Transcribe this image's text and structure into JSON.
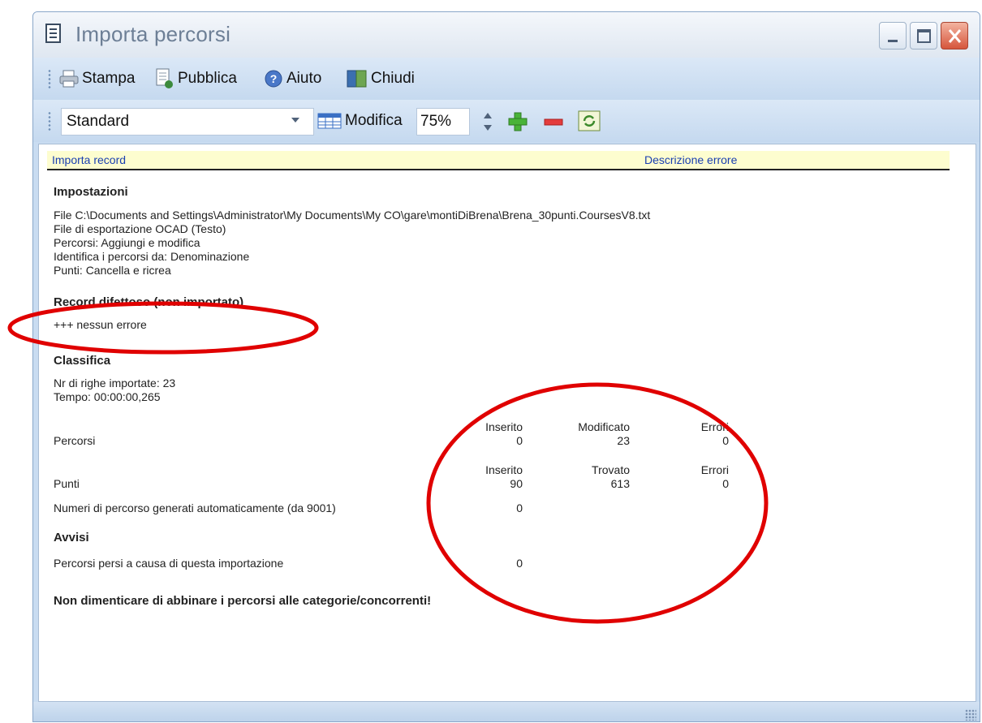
{
  "window": {
    "title": "Importa percorsi"
  },
  "toolbar": {
    "print_label": "Stampa",
    "publish_label": "Pubblica",
    "help_label": "Aiuto",
    "close_label": "Chiudi",
    "layout_value": "Standard",
    "edit_label": "Modifica",
    "zoom_value": "75%"
  },
  "report": {
    "col1": "Importa record",
    "col2": "Descrizione errore",
    "settings": {
      "heading": "Impostazioni",
      "lines": [
        "File C:\\Documents and Settings\\Administrator\\My Documents\\My CO\\gare\\montiDiBrena\\Brena_30punti.CoursesV8.txt",
        "File di esportazione OCAD (Testo)",
        "Percorsi: Aggiungi e modifica",
        "Identifica i percorsi da: Denominazione",
        "Punti: Cancella e ricrea"
      ]
    },
    "faulty": {
      "heading": "Record difettoso (non importato)",
      "line": "+++ nessun errore"
    },
    "summary": {
      "heading": "Classifica",
      "rows_imported": "Nr di righe importate: 23",
      "time": "Tempo: 00:00:00,265"
    },
    "courses": {
      "label": "Percorsi",
      "h1": "Inserito",
      "h2": "Modificato",
      "h3": "Errori",
      "v1": "0",
      "v2": "23",
      "v3": "0"
    },
    "controls": {
      "label": "Punti",
      "h1": "Inserito",
      "h2": "Trovato",
      "h3": "Errori",
      "v1": "90",
      "v2": "613",
      "v3": "0"
    },
    "autonumbers": {
      "label": "Numeri di percorso generati automaticamente (da 9001)",
      "value": "0"
    },
    "warnings": {
      "heading": "Avvisi",
      "lost_label": "Percorsi persi a causa di questa importazione",
      "lost_value": "0"
    },
    "reminder": "Non dimenticare di abbinare i percorsi alle categorie/concorrenti!"
  },
  "colors": {
    "annotation": "#e00000",
    "header_bg": "#fdfdcf",
    "header_text": "#1a3fb0"
  }
}
